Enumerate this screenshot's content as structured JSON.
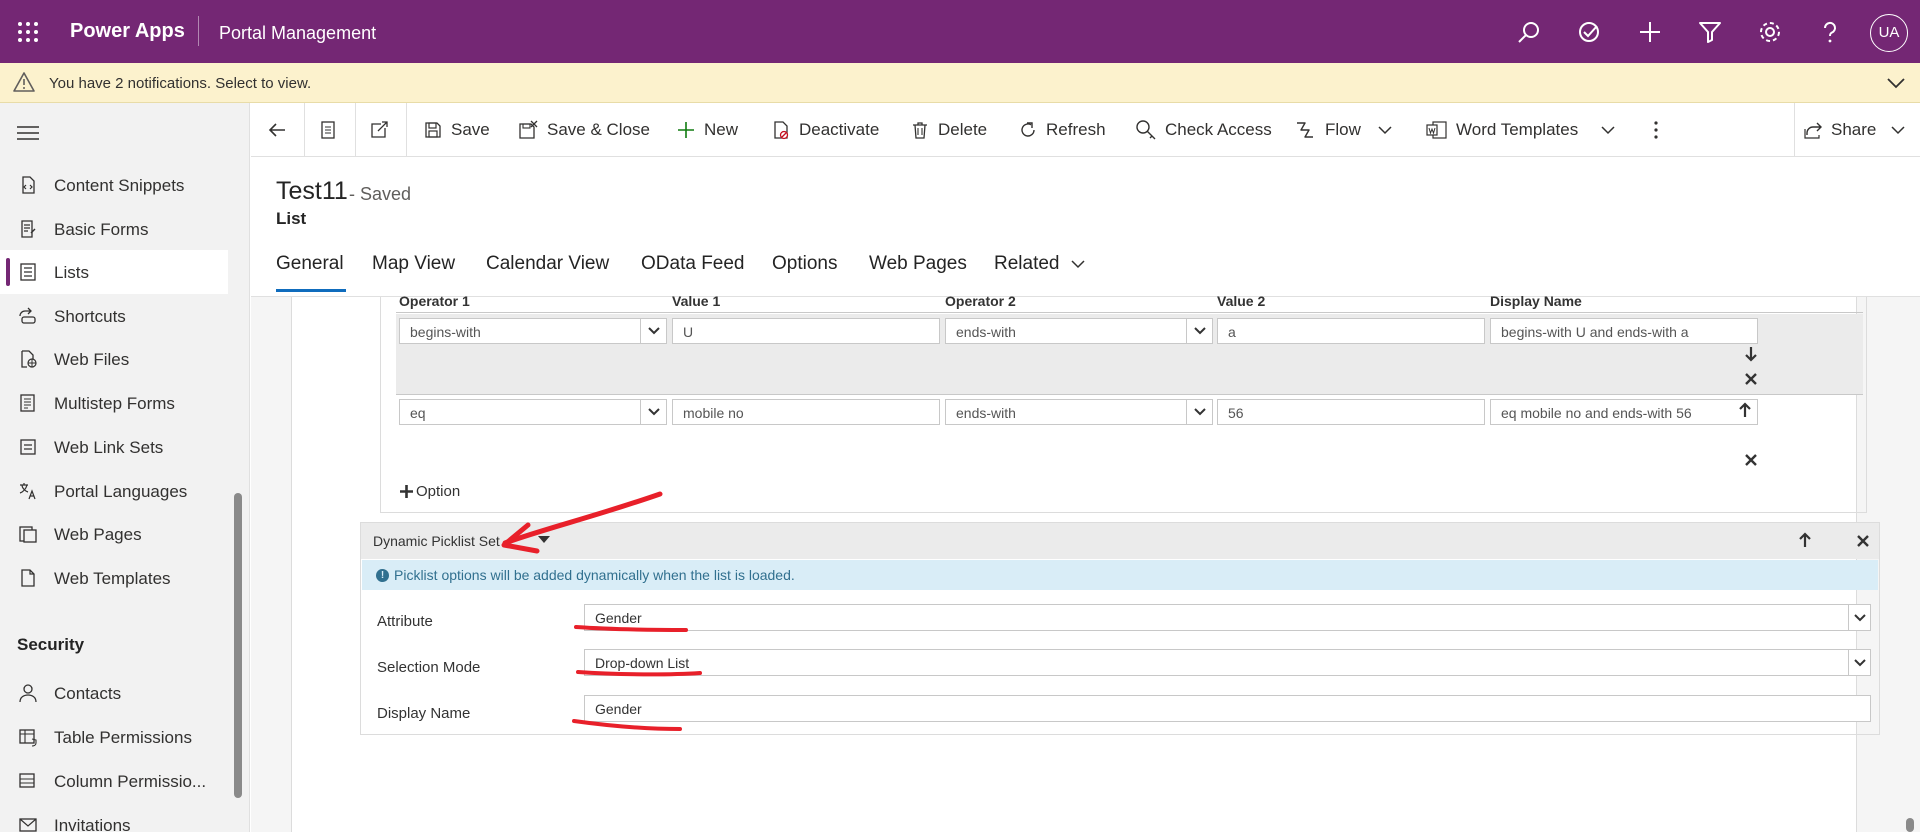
{
  "topbar": {
    "brand": "Power Apps",
    "app": "Portal Management",
    "user_initials": "UA",
    "bg": "#742774"
  },
  "notification": {
    "text": "You have 2 notifications. Select to view."
  },
  "sidebar": {
    "items": [
      {
        "label": "Content Snippets",
        "icon": "content-snippet-icon"
      },
      {
        "label": "Basic Forms",
        "icon": "form-icon"
      },
      {
        "label": "Lists",
        "icon": "list-icon",
        "selected": true
      },
      {
        "label": "Shortcuts",
        "icon": "shortcut-icon"
      },
      {
        "label": "Web Files",
        "icon": "web-file-icon"
      },
      {
        "label": "Multistep Forms",
        "icon": "multistep-form-icon"
      },
      {
        "label": "Web Link Sets",
        "icon": "link-icon"
      },
      {
        "label": "Portal Languages",
        "icon": "language-icon"
      },
      {
        "label": "Web Pages",
        "icon": "web-page-icon"
      },
      {
        "label": "Web Templates",
        "icon": "template-icon"
      }
    ],
    "section": "Security",
    "security_items": [
      {
        "label": "Contacts",
        "icon": "person-icon"
      },
      {
        "label": "Table Permissions",
        "icon": "table-permission-icon"
      },
      {
        "label": "Column Permissio...",
        "icon": "column-permission-icon"
      },
      {
        "label": "Invitations",
        "icon": "invitation-icon"
      }
    ]
  },
  "commands": {
    "save": "Save",
    "save_close": "Save & Close",
    "new": "New",
    "deactivate": "Deactivate",
    "delete": "Delete",
    "refresh": "Refresh",
    "check_access": "Check Access",
    "flow": "Flow",
    "word_templates": "Word Templates",
    "share": "Share"
  },
  "record": {
    "title": "Test11",
    "status": "- Saved",
    "type": "List"
  },
  "tabs": [
    "General",
    "Map View",
    "Calendar View",
    "OData Feed",
    "Options",
    "Web Pages",
    "Related"
  ],
  "filter": {
    "columns": [
      "Operator 1",
      "Value 1",
      "Operator 2",
      "Value 2",
      "Display Name"
    ],
    "rows": [
      {
        "op1": "begins-with",
        "val1": "U",
        "op2": "ends-with",
        "val2": "a",
        "display": "begins-with U and ends-with a"
      },
      {
        "op1": "eq",
        "val1": "mobile no",
        "op2": "ends-with",
        "val2": "56",
        "display": "eq mobile no and ends-with 56"
      }
    ],
    "add_option": "Option"
  },
  "picklist": {
    "title": "Dynamic Picklist Set",
    "info": "Picklist options will be added dynamically when the list is loaded.",
    "attribute_label": "Attribute",
    "attribute_value": "Gender",
    "mode_label": "Selection Mode",
    "mode_value": "Drop-down List",
    "display_label": "Display Name",
    "display_value": "Gender"
  },
  "annotation_color": "#e8202a"
}
